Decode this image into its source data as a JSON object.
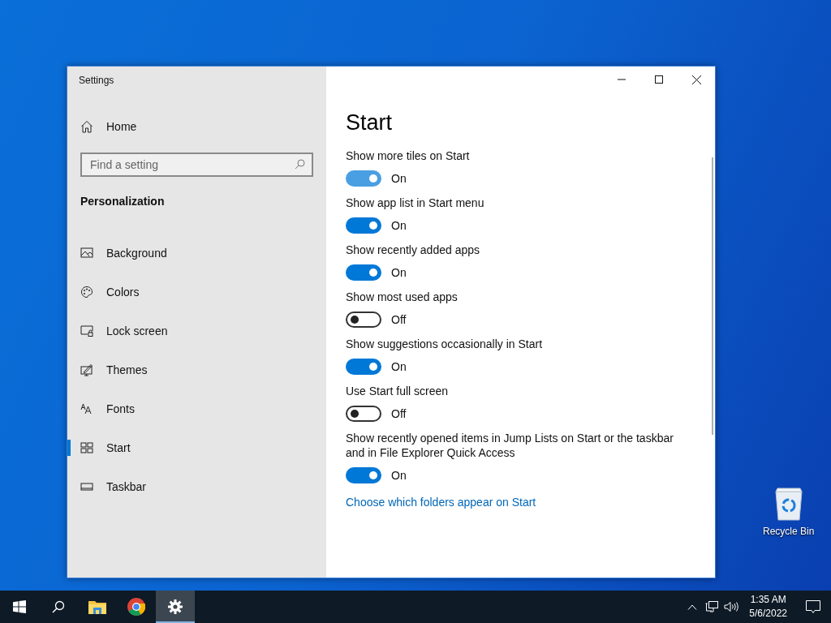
{
  "desktop": {
    "icons": [
      {
        "label": "Recycle Bin"
      }
    ]
  },
  "window": {
    "title": "Settings"
  },
  "sidebar": {
    "home": "Home",
    "search": {
      "placeholder": "Find a setting"
    },
    "section": "Personalization",
    "items": [
      {
        "label": "Background",
        "selected": false
      },
      {
        "label": "Colors",
        "selected": false
      },
      {
        "label": "Lock screen",
        "selected": false
      },
      {
        "label": "Themes",
        "selected": false
      },
      {
        "label": "Fonts",
        "selected": false
      },
      {
        "label": "Start",
        "selected": true
      },
      {
        "label": "Taskbar",
        "selected": false
      }
    ]
  },
  "page": {
    "title": "Start",
    "settings": [
      {
        "label": "Show more tiles on Start",
        "on": true,
        "hovered": true,
        "state": "On"
      },
      {
        "label": "Show app list in Start menu",
        "on": true,
        "hovered": false,
        "state": "On"
      },
      {
        "label": "Show recently added apps",
        "on": true,
        "hovered": false,
        "state": "On"
      },
      {
        "label": "Show most used apps",
        "on": false,
        "hovered": false,
        "state": "Off"
      },
      {
        "label": "Show suggestions occasionally in Start",
        "on": true,
        "hovered": false,
        "state": "On"
      },
      {
        "label": "Use Start full screen",
        "on": false,
        "hovered": false,
        "state": "Off"
      },
      {
        "label": "Show recently opened items in Jump Lists on Start or the taskbar and in File Explorer Quick Access",
        "on": true,
        "hovered": false,
        "state": "On"
      }
    ],
    "link": "Choose which folders appear on Start"
  },
  "taskbar": {
    "apps": [
      {
        "kind": "start",
        "selected": false
      },
      {
        "kind": "search",
        "selected": false
      },
      {
        "kind": "folder",
        "selected": false
      },
      {
        "kind": "browser",
        "selected": false
      },
      {
        "kind": "settings",
        "selected": true
      }
    ],
    "time": "1:35 AM",
    "date": "5/6/2022"
  }
}
